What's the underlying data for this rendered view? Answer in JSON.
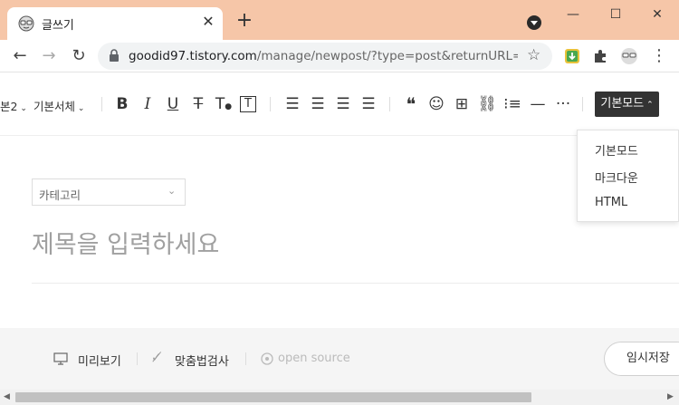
{
  "tab": {
    "title": "글쓰기",
    "close": "✕",
    "new_tab": "+"
  },
  "window": {
    "minimize": "—",
    "maximize": "☐",
    "close": "✕"
  },
  "address": {
    "url_host": "goodid97.tistory.com",
    "url_rest": "/manage/newpost/?type=post&returnURL=..."
  },
  "toolbar": {
    "heading_partial": "본2",
    "font_family": "기본서체",
    "mode_button": "기본모드"
  },
  "mode_menu": {
    "items": [
      "기본모드",
      "마크다운",
      "HTML"
    ]
  },
  "editor": {
    "category_label": "카테고리",
    "title_placeholder": "제목을 입력하세요"
  },
  "bottom": {
    "preview": "미리보기",
    "spellcheck": "맞춤법검사",
    "open_source": "open source",
    "temp_save": "임시저장"
  },
  "colors": {
    "titlebar": "#f6c6a8",
    "mode_button_bg": "#333333",
    "extension_green": "#4aa84f"
  }
}
